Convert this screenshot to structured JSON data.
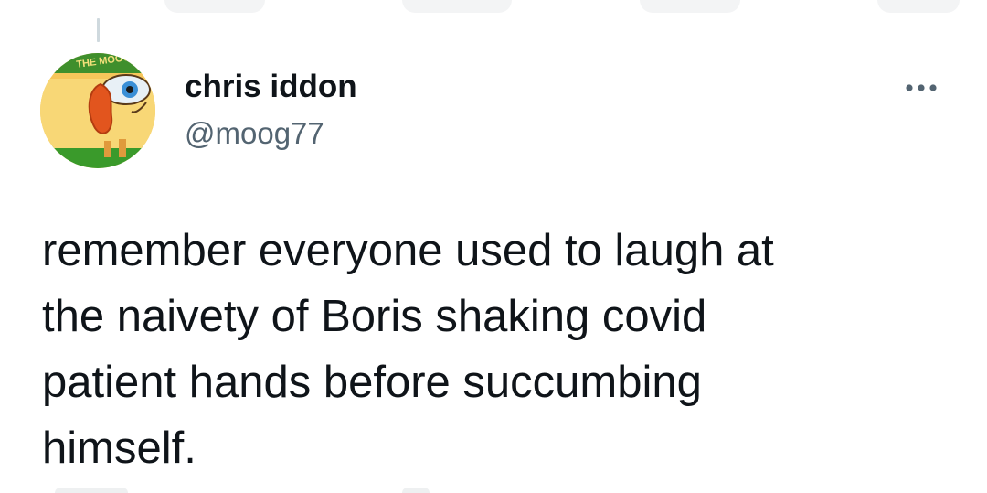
{
  "tweet": {
    "author": {
      "display_name": "chris iddon",
      "handle": "@moog77",
      "avatar_text": "THE MOOG"
    },
    "more_icon": "more-horizontal-icon",
    "text_lines": [
      "remember everyone used to laugh at",
      "the naivety of Boris shaking covid",
      "patient hands before succumbing",
      "himself."
    ]
  },
  "colors": {
    "text_primary": "#0f1419",
    "text_secondary": "#536471",
    "thread_line": "#cfd9de",
    "background": "#ffffff"
  }
}
